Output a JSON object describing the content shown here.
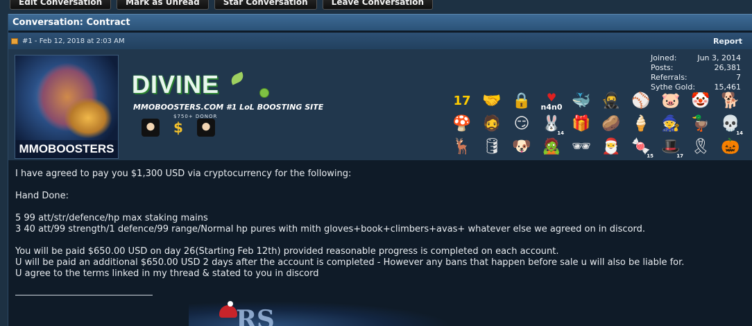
{
  "buttons": {
    "edit": "Edit Conversation",
    "unread": "Mark as Unread",
    "star": "Star Conversation",
    "leave": "Leave Conversation"
  },
  "conversation": {
    "title": "Conversation: Contract"
  },
  "post": {
    "meta": "#1 - Feb 12, 2018 at 2:03 AM",
    "report": "Report"
  },
  "user": {
    "avatar_text": "MMOBOOSTERS",
    "logo": "DIVINE",
    "tagline": "MMOBOOSTERS.COM #1 LoL BOOSTING SITE",
    "donor": "$750+ DONOR",
    "stats": [
      {
        "label": "Joined:",
        "value": "Jun 3, 2014"
      },
      {
        "label": "Posts:",
        "value": "26,381"
      },
      {
        "label": "Referrals:",
        "value": "7"
      },
      {
        "label": "Sythe Gold:",
        "value": "15,461"
      }
    ],
    "awards": [
      {
        "name": "award-17-icon",
        "glyph": "17",
        "cls": "num17"
      },
      {
        "name": "handshake-icon",
        "glyph": "🤝"
      },
      {
        "name": "padlock-icon",
        "glyph": "🔒"
      },
      {
        "name": "n4n0-heart-icon",
        "glyph": "n4n0",
        "cls": "n4n0"
      },
      {
        "name": "whale-icon",
        "glyph": "🐳"
      },
      {
        "name": "ninja-icon",
        "glyph": "🥷"
      },
      {
        "name": "pokeball-icon",
        "glyph": "⚾"
      },
      {
        "name": "pig-icon",
        "glyph": "🐷"
      },
      {
        "name": "jester-hat-icon",
        "glyph": "🤡"
      },
      {
        "name": "rainbow-dog-icon",
        "glyph": "🐕"
      },
      {
        "name": "mushroom-icon",
        "glyph": "🍄"
      },
      {
        "name": "homer-icon",
        "glyph": "🧔"
      },
      {
        "name": "troll-face-icon",
        "glyph": "😏"
      },
      {
        "name": "bunny-icon",
        "glyph": "🐰",
        "num": "14"
      },
      {
        "name": "gift-icon",
        "glyph": "🎁"
      },
      {
        "name": "potato-icon",
        "glyph": "🥔"
      },
      {
        "name": "ice-cream-icon",
        "glyph": "🍦"
      },
      {
        "name": "gnome-icon",
        "glyph": "🧙"
      },
      {
        "name": "duck-icon",
        "glyph": "🦆"
      },
      {
        "name": "skull-icon",
        "glyph": "💀",
        "num": "14"
      },
      {
        "name": "reindeer-icon",
        "glyph": "🦌"
      },
      {
        "name": "barrel-icon",
        "glyph": "🛢"
      },
      {
        "name": "doge-icon",
        "glyph": "🐶"
      },
      {
        "name": "zombie-icon",
        "glyph": "🧟"
      },
      {
        "name": "heisenberg-icon",
        "glyph": "🕶"
      },
      {
        "name": "santa-icon",
        "glyph": "🎅"
      },
      {
        "name": "candy-cane-icon",
        "glyph": "🍬",
        "num": "15"
      },
      {
        "name": "leprechaun-hat-icon",
        "glyph": "🎩",
        "num": "17"
      },
      {
        "name": "ribbon-icon",
        "glyph": "🎗"
      },
      {
        "name": "pumpkin-icon",
        "glyph": "🎃"
      }
    ]
  },
  "message": {
    "lines": [
      "I have agreed to pay you $1,300 USD via cryptocurrency for the following:",
      "",
      "Hand Done:",
      "",
      "5 99 att/str/defence/hp max staking mains",
      "3 40 att/99 strength/1 defence/99 range/Normal hp pures with mith gloves+book+climbers+avas+ whatever else we agreed on in discord.",
      "",
      "You will be paid $650.00 USD on day 26(Starting Feb 12th) provided reasonable progress is completed on each account.",
      "U will be paid an additional $650.00 USD 2 days after the account is completed - However any bans that happen before sale u will also be liable for.",
      "U agree to the terms linked in my thread & stated to you in discord"
    ]
  },
  "signature": {
    "image_text": "RS"
  }
}
